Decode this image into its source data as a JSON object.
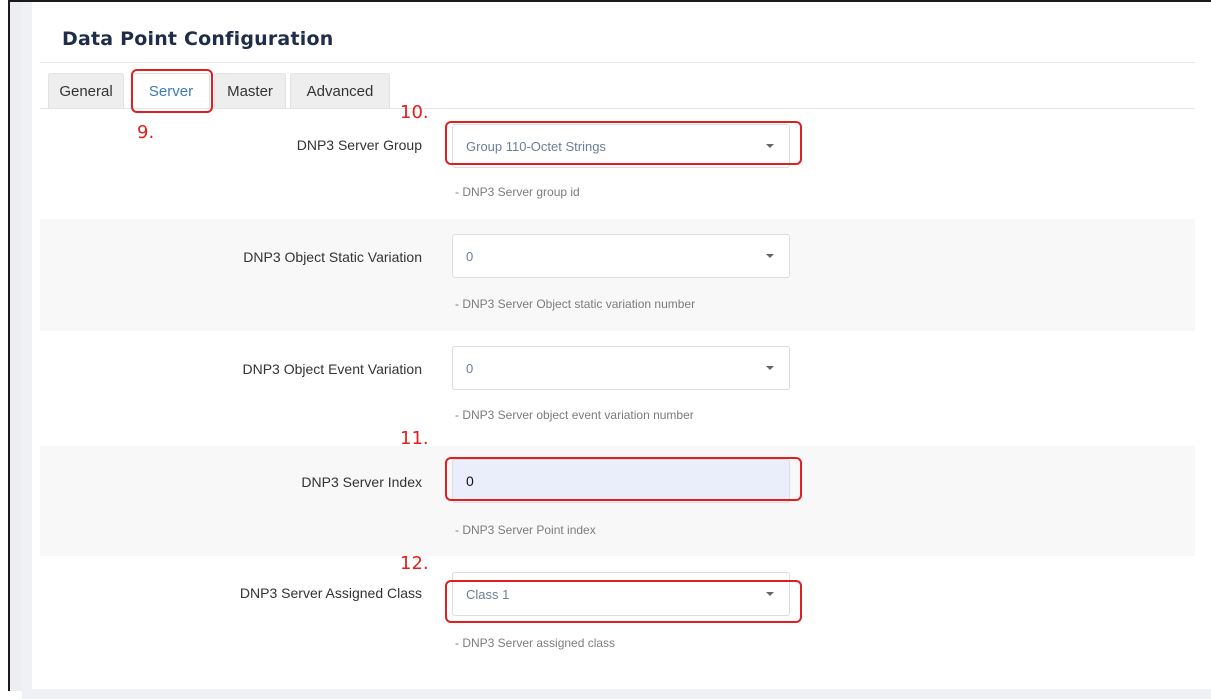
{
  "page": {
    "title": "Data Point Configuration"
  },
  "tabs": [
    {
      "label": "General",
      "active": false
    },
    {
      "label": "Server",
      "active": true
    },
    {
      "label": "Master",
      "active": false
    },
    {
      "label": "Advanced",
      "active": false
    }
  ],
  "fields": {
    "server_group": {
      "label": "DNP3 Server Group",
      "value": "Group 110-Octet Strings",
      "help": "- DNP3 Server group id"
    },
    "static_variation": {
      "label": "DNP3 Object Static Variation",
      "value": "0",
      "help": "- DNP3 Server Object static variation number"
    },
    "event_variation": {
      "label": "DNP3 Object Event Variation",
      "value": "0",
      "help": "- DNP3 Server object event variation number"
    },
    "server_index": {
      "label": "DNP3 Server Index",
      "value": "0",
      "help": "- DNP3 Server Point index"
    },
    "assigned_class": {
      "label": "DNP3 Server Assigned Class",
      "value": "Class 1",
      "help": "- DNP3 Server assigned class"
    }
  },
  "annotations": {
    "step_9": "9.",
    "step_10": "10.",
    "step_11": "11.",
    "step_12": "12."
  },
  "colors": {
    "title": "#1f2d4a",
    "active_tab_text": "#3d7ab8",
    "highlight": "#e02020",
    "row_shade": "#f8f8f8",
    "input_fill": "#e9eefa"
  }
}
